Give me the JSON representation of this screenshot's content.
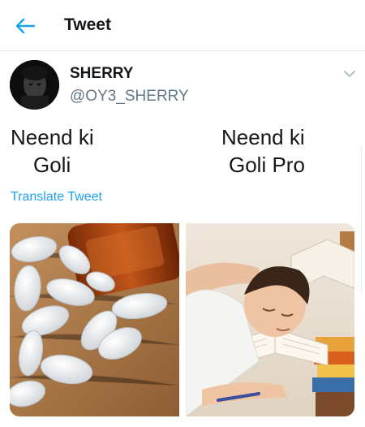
{
  "header": {
    "title": "Tweet",
    "back_icon": "arrow-left-icon"
  },
  "author": {
    "name": "SHERRY",
    "handle": "@OY3_SHERRY"
  },
  "tweet": {
    "left_caption_line1": "Neend ki",
    "left_caption_line2": "Goli",
    "right_caption_line1": "Neend ki",
    "right_caption_line2": "Goli Pro",
    "translate_label": "Translate Tweet"
  },
  "colors": {
    "accent": "#1da1f2",
    "secondary_text": "#657786"
  }
}
